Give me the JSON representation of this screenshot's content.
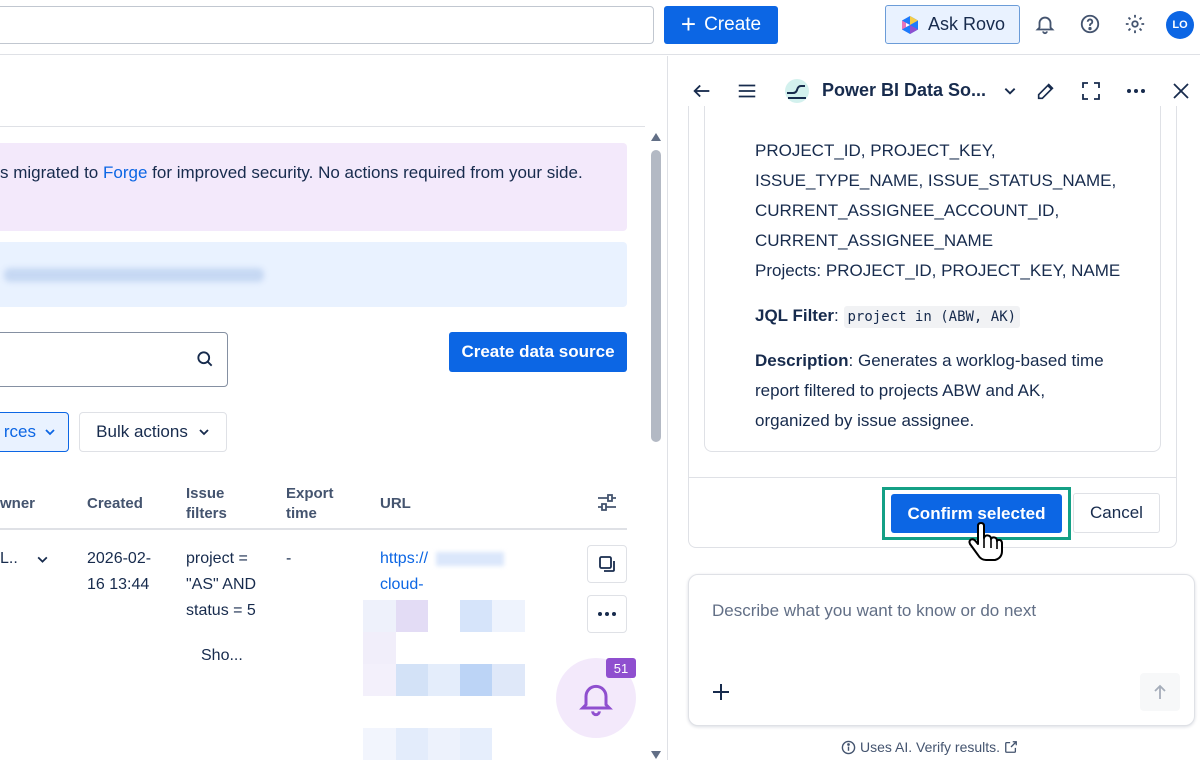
{
  "topbar": {
    "create_label": "Create",
    "rovo_label": "Ask Rovo",
    "avatar_initials": "LO"
  },
  "banner": {
    "purple_text_before": "s migrated to ",
    "purple_link": "Forge",
    "purple_text_after": " for improved security. No actions required from your side."
  },
  "toolbar": {
    "create_data_source_label": "Create data source",
    "sources_filter_label": "rces",
    "bulk_actions_label": "Bulk actions"
  },
  "table": {
    "headers": {
      "owner": "wner",
      "created": "Created",
      "issue_filters_line1": "Issue",
      "issue_filters_line2": "filters",
      "export_time_line1": "Export",
      "export_time_line2": "time",
      "url": "URL"
    },
    "row": {
      "owner": "L..",
      "created_line1": "2026-02-",
      "created_line2": "16 13:44",
      "filter_line1": "project =",
      "filter_line2": "\"AS\" AND",
      "filter_line3": "status = 5",
      "show_more": "Sho...",
      "export_time": "-",
      "url_line1": "https://",
      "url_line2": "cloud-"
    }
  },
  "notifications": {
    "count": "51"
  },
  "panel": {
    "title": "Power BI Data So...",
    "card": {
      "line1": "PROJECT_ID, PROJECT_KEY,",
      "line2": "ISSUE_TYPE_NAME, ISSUE_STATUS_NAME,",
      "line3": "CURRENT_ASSIGNEE_ACCOUNT_ID,",
      "line4": "CURRENT_ASSIGNEE_NAME",
      "line5": "Projects: PROJECT_ID, PROJECT_KEY, NAME",
      "jql_label": "JQL Filter",
      "jql_value": "project in (ABW, AK)",
      "desc_label": "Description",
      "desc_line1": ": Generates a worklog-based time",
      "desc_line2": "report filtered to projects ABW and AK,",
      "desc_line3": "organized by issue assignee."
    },
    "confirm_label": "Confirm selected",
    "cancel_label": "Cancel",
    "composer_placeholder": "Describe what you want to know or do next",
    "footer_note": "Uses AI. Verify results."
  },
  "colors": {
    "primary": "#0c66e4",
    "highlight_border": "#14a085",
    "purple_banner": "#f3e9fb",
    "blue_banner": "#e9f2ff",
    "notif_badge": "#8f4fcf"
  }
}
